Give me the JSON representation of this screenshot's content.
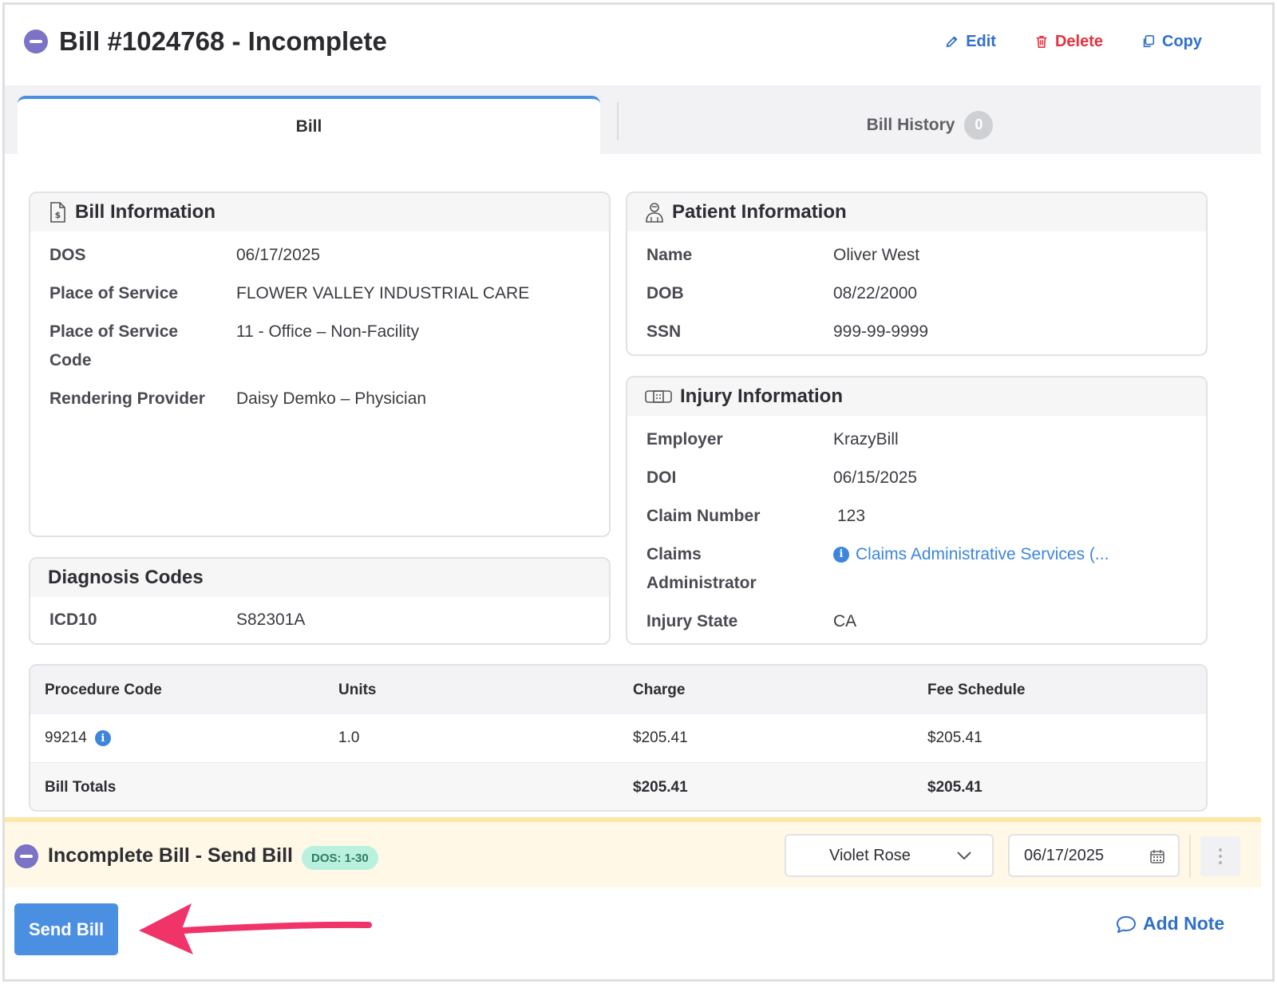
{
  "header": {
    "title": "Bill #1024768 - Incomplete",
    "actions": {
      "edit": "Edit",
      "delete": "Delete",
      "copy": "Copy"
    }
  },
  "tabs": {
    "bill": "Bill",
    "history": "Bill History",
    "history_count": "0"
  },
  "bill_info": {
    "title": "Bill Information",
    "rows": [
      {
        "label": "DOS",
        "value": "06/17/2025"
      },
      {
        "label": "Place of Service",
        "value": "FLOWER VALLEY INDUSTRIAL CARE"
      },
      {
        "label": "Place of Service Code",
        "value": "11 - Office – Non-Facility"
      },
      {
        "label": "Rendering Provider",
        "value": "Daisy Demko – Physician"
      }
    ]
  },
  "patient_info": {
    "title": "Patient Information",
    "rows": [
      {
        "label": "Name",
        "value": "Oliver West"
      },
      {
        "label": "DOB",
        "value": "08/22/2000"
      },
      {
        "label": "SSN",
        "value": "999-99-9999"
      }
    ]
  },
  "injury_info": {
    "title": "Injury Information",
    "rows": [
      {
        "label": "Employer",
        "value": "KrazyBill"
      },
      {
        "label": "DOI",
        "value": "06/15/2025"
      },
      {
        "label": "Claim Number",
        "value": "123"
      },
      {
        "label": "Claims Administrator",
        "value": "Claims Administrative Services (..."
      },
      {
        "label": "Injury State",
        "value": "CA"
      }
    ]
  },
  "diagnosis": {
    "title": "Diagnosis Codes",
    "rows": [
      {
        "label": "ICD10",
        "value": "S82301A"
      }
    ]
  },
  "procedures": {
    "headers": [
      "Procedure Code",
      "Units",
      "Charge",
      "Fee Schedule"
    ],
    "rows": [
      {
        "code": "99214",
        "units": "1.0",
        "charge": "$205.41",
        "fee": "$205.41"
      }
    ],
    "totals": {
      "label": "Bill Totals",
      "charge": "$205.41",
      "fee": "$205.41"
    }
  },
  "status_bar": {
    "title": "Incomplete Bill - Send Bill",
    "badge": "DOS: 1-30",
    "assignee": "Violet Rose",
    "date": "06/17/2025"
  },
  "footer": {
    "send_label": "Send Bill",
    "add_note_label": "Add Note"
  },
  "colors": {
    "accent": "#4b8fe2",
    "danger": "#e5323e",
    "status_purple": "#7a73c6",
    "highlight_arrow": "#f0346a"
  }
}
